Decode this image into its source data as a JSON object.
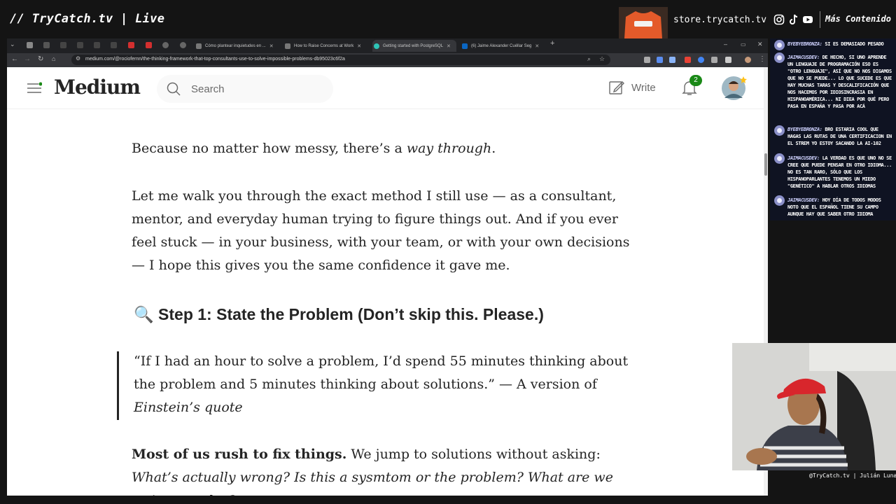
{
  "stream": {
    "title": "// TryCatch.tv | Live",
    "store_url": "store.trycatch.tv",
    "more_content": "Más Contenido",
    "footer": "@TryCatch.tv | Julián Luna"
  },
  "browser": {
    "tabs": [
      {
        "title": "Cómo plantear inquietudes en ...",
        "favicon_color": "#777777"
      },
      {
        "title": "How to Raise Concerns at Work",
        "favicon_color": "#777777"
      },
      {
        "title": "Getting started with PostgreSQL",
        "favicon_color": "#2ec4b6"
      },
      {
        "title": "(6) Jaime Alexander Cuéllar Seg",
        "favicon_color": "#0a66c2"
      }
    ],
    "url": "medium.com/@rociofernn/the-thinking-framework-that-top-consultants-use-to-solve-impossible-problems-db95023c6f2a",
    "new_tab_label": "+"
  },
  "medium": {
    "logo": "Medium",
    "search_placeholder": "Search",
    "write_label": "Write",
    "notification_count": "2"
  },
  "article": {
    "p1": {
      "text": "Because no matter how messy, there’s a ",
      "em": "way through",
      "end": "."
    },
    "p2": "Let me walk you through the exact method I still use — as a consultant, mentor, and everyday human trying to figure things out. And if you ever feel stuck — in your business, with your team, or with your own decisions — I hope this gives you the same confidence it gave me.",
    "h2_icon": "🔍",
    "h2": "Step 1: State the Problem (Don’t skip this. Please.)",
    "quote": {
      "text": "“If I had an hour to solve a problem, I’d spend 55 minutes thinking about the problem and 5 minutes thinking about solutions.” — A version of ",
      "em": "Einstein’s quote"
    },
    "p3": {
      "strong": "Most of us rush to fix things.",
      "text": " We jump to solutions without asking: ",
      "em": "What’s actually wrong? Is this a sysmtom or the problem? What are we trying to solve?"
    }
  },
  "chat": [
    {
      "user": "ByeByeBronza:",
      "text": "si es demasiado pesado"
    },
    {
      "user": "JaimacusDev:",
      "text": "de hecho, si uno aprende un lenguaje de programación eso es \"otro lenguaje\", así que no nos digamos que no se puede... lo que sucede es que hay muchas taras y descalificación que nos hacemos por idiosincrasia en hispanoamérica... ni diea por qué pero pasa en España y pasa por acá"
    },
    {
      "user": "ByeByeBronza:",
      "text": "bro estaria cool que hagas las rutas de una certificacion en el strem yo estoy sacando la AI-102"
    },
    {
      "user": "JaimacusDev:",
      "text": "la verdad es que uno no se cree que puede pensar en otro idioma... no es tan raro, sólo que los hispanoparlantes tenemos un miedo \"genético\" a hablar otros idiomas"
    },
    {
      "user": "JaimacusDev:",
      "text": "hoy día de todos modos noto que el español tiene su campo aunque hay que saber otro idioma"
    }
  ],
  "colors": {
    "medium_green": "#1a8917",
    "text": "#242424",
    "muted": "#6b6b6b",
    "chat_bg": "#0f1322"
  }
}
